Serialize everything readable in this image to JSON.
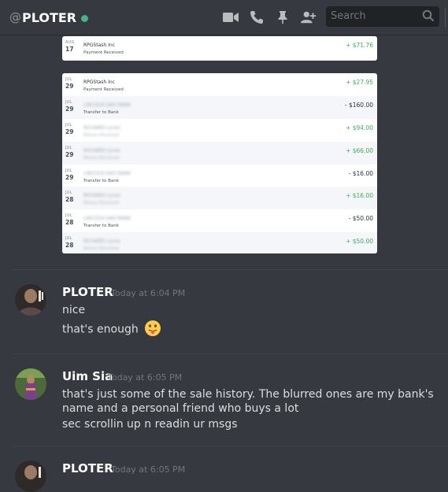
{
  "header": {
    "at": "@",
    "channel_name": "PLOTER",
    "search_placeholder": "Search",
    "icons": [
      "video-call-icon",
      "voice-call-icon",
      "pin-icon",
      "add-friend-icon"
    ]
  },
  "transactions_top": [
    {
      "month": "AUG",
      "day": "17",
      "name": "RPGStash Inc",
      "desc": "Payment Received",
      "amount": "+ $71.76",
      "positive": true
    }
  ],
  "transactions": [
    {
      "month": "JUL",
      "day": "29",
      "name": "RPGStash Inc",
      "desc": "Payment Received",
      "amount": "+ $27.95",
      "positive": true
    },
    {
      "month": "JUL",
      "day": "29",
      "name": "LINCOLN SAVI BANK",
      "desc": "Transfer to Bank",
      "amount": "- $160.00",
      "positive": false
    },
    {
      "month": "JUL",
      "day": "29",
      "name": "RICHARD Lucas",
      "desc": "Money Received",
      "amount": "+ $94.00",
      "positive": true
    },
    {
      "month": "JUL",
      "day": "29",
      "name": "RICHARD Lucas",
      "desc": "Money Received",
      "amount": "+ $66.00",
      "positive": true
    },
    {
      "month": "JUL",
      "day": "29",
      "name": "LINCOLN SAVI BANK",
      "desc": "Transfer to Bank",
      "amount": "- $16.00",
      "positive": false
    },
    {
      "month": "JUL",
      "day": "28",
      "name": "RICHARD Lucas",
      "desc": "Money Received",
      "amount": "+ $16.00",
      "positive": true
    },
    {
      "month": "JUL",
      "day": "28",
      "name": "LINCOLN SAVI BANK",
      "desc": "Transfer to Bank",
      "amount": "- $50.00",
      "positive": false
    },
    {
      "month": "JUL",
      "day": "28",
      "name": "RICHARD Lucas",
      "desc": "Money Received",
      "amount": "+ $50.00",
      "positive": true
    }
  ],
  "messages": [
    {
      "author": "PLOTER",
      "timestamp": "Today at 6:04 PM",
      "lines": [
        "nice",
        "that's enough"
      ]
    },
    {
      "author": "Uim Sia",
      "timestamp": "Today at 6:05 PM",
      "lines": [
        "that's just some of the sale history. The blurred ones are my bank's name and a personal friend who buys a lot",
        "sec scrollin up n readin ur msgs"
      ]
    },
    {
      "author": "PLOTER",
      "timestamp": "Today at 6:05 PM",
      "lines": []
    }
  ],
  "colors": {
    "background": "#36393f",
    "online": "#43b581",
    "positive_amount": "#3dae5a"
  }
}
